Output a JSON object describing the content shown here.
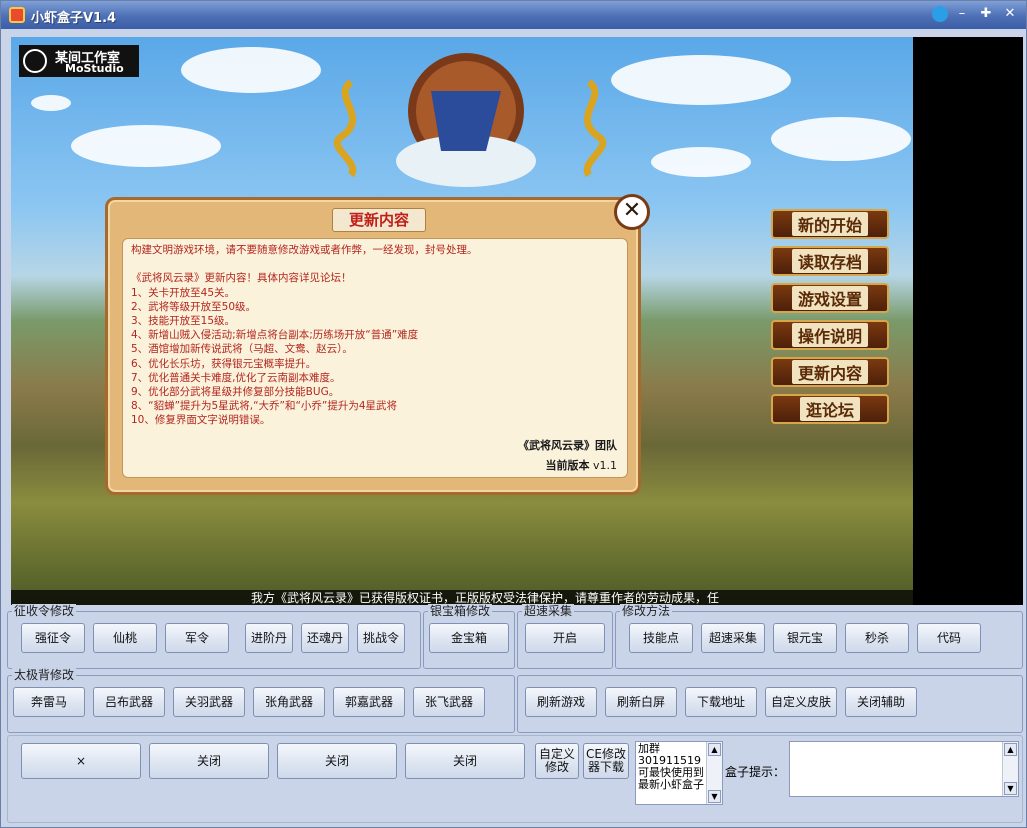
{
  "window": {
    "title": "小虾盒子V1.4"
  },
  "game": {
    "studio_name_cn": "某间工作室",
    "studio_name_en": "MoStudio",
    "menu": [
      "新的开始",
      "读取存档",
      "游戏设置",
      "操作说明",
      "更新内容",
      "逛论坛"
    ],
    "dialog": {
      "title": "更新内容",
      "lines": [
        "构建文明游戏环境，请不要随意修改游戏或者作弊，一经发现，封号处理。",
        "",
        "《武将风云录》更新内容！具体内容详见论坛！",
        "1、关卡开放至45关。",
        "2、武将等级开放至50级。",
        "3、技能开放至15级。",
        "4、新增山贼入侵活动;新增点将台副本;历练场开放“普通”难度",
        "5、酒馆增加新传说武将（马超、文鸯、赵云）。",
        "6、优化长乐坊，获得银元宝概率提升。",
        "7、优化普通关卡难度,优化了云南副本难度。",
        "9、优化部分武将星级并修复部分技能BUG。",
        "8、“貂蝉”提升为5星武将,“大乔”和“小乔”提升为4星武将",
        "10、修复界面文字说明错误。"
      ],
      "team": "《武将风云录》团队",
      "version_label": "当前版本",
      "version": "v1.1"
    },
    "ticker": "我方《武将风云录》已获得版权证书，正版版权受法律保护，请尊重作者的劳动成果，任"
  },
  "groups": {
    "zhengshou": {
      "label": "征收令修改",
      "buttons": [
        "强征令",
        "仙桃",
        "军令",
        "进阶丹",
        "还魂丹",
        "挑战令"
      ]
    },
    "yinbao": {
      "label": "银宝箱修改",
      "buttons": [
        "金宝箱"
      ]
    },
    "chaosu": {
      "label": "超速采集",
      "buttons": [
        "开启"
      ]
    },
    "xiugai": {
      "label": "修改方法",
      "buttons": [
        "技能点",
        "超速采集",
        "银元宝",
        "秒杀",
        "代码"
      ]
    },
    "taiji": {
      "label": "太极背修改",
      "buttons": [
        "奔雷马",
        "吕布武器",
        "关羽武器",
        "张角武器",
        "郭嘉武器",
        "张飞武器"
      ]
    },
    "tools": {
      "buttons": [
        "刷新游戏",
        "刷新白屏",
        "下载地址",
        "自定义皮肤",
        "关闭辅助"
      ]
    }
  },
  "bottom": {
    "buttons": [
      "×",
      "关闭",
      "关闭",
      "关闭"
    ],
    "custom": "自定义修改",
    "ce": "CE修改器下载",
    "notice": "加群301911519可最快使用到最新小虾盒子",
    "hint_label": "盒子提示："
  }
}
